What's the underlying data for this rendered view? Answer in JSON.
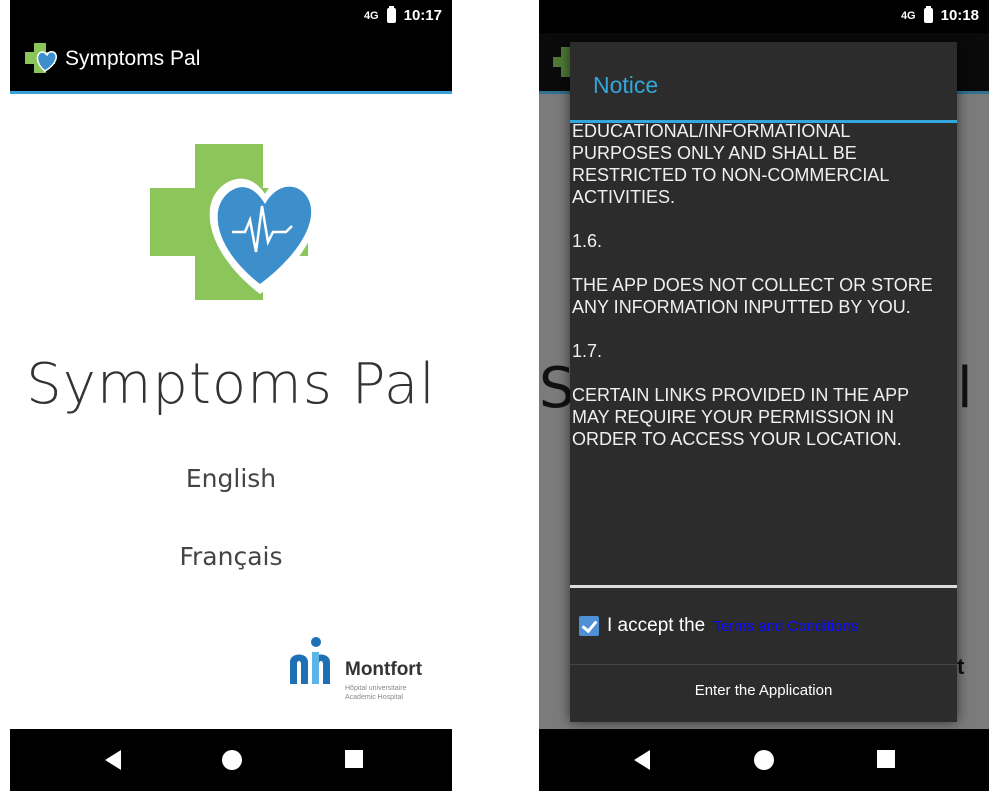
{
  "screen1": {
    "status": {
      "network": "4G",
      "time": "10:17"
    },
    "appbar": {
      "title": "Symptoms Pal"
    },
    "app_name": "Symptoms Pal",
    "languages": [
      "English",
      "Français"
    ],
    "sponsor": {
      "name": "Montfort",
      "subtitle_line1": "Hôpital universitaire",
      "subtitle_line2": "Academic Hospital"
    }
  },
  "screen2": {
    "status": {
      "network": "4G",
      "time": "10:18"
    },
    "dialog": {
      "title": "Notice",
      "paragraphs": [
        "EDUCATIONAL/INFORMATIONAL PURPOSES ONLY AND SHALL BE RESTRICTED TO NON-COMMERCIAL ACTIVITIES.",
        "1.6.",
        "THE APP DOES NOT COLLECT OR STORE ANY INFORMATION INPUTTED BY YOU.",
        "1.7.",
        "CERTAIN LINKS PROVIDED IN THE APP MAY REQUIRE YOUR PERMISSION IN ORDER TO ACCESS YOUR LOCATION."
      ],
      "accept_prefix": "I accept the",
      "accept_link": "Terms and Conditions",
      "accept_checked": true,
      "enter_button": "Enter the Application"
    }
  },
  "colors": {
    "accent": "#38a1d6",
    "cross_green": "#8cc65a",
    "heart_blue": "#3d8fcc",
    "link_blue": "#0a0aff"
  }
}
